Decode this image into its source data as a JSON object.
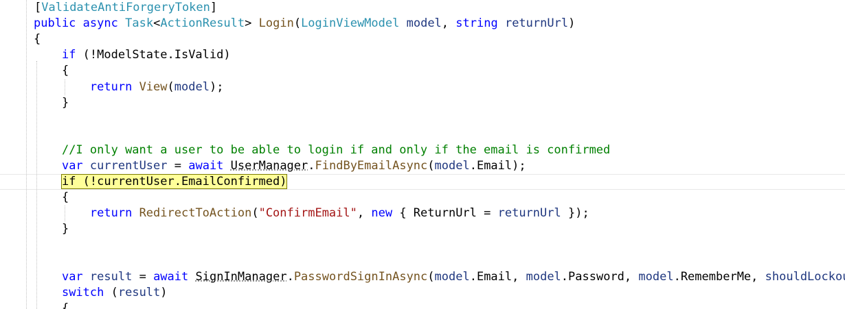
{
  "editor": {
    "language": "csharp",
    "current_line_index": 11,
    "lines": [
      {
        "tokens": [
          {
            "t": "",
            "c": "plain"
          },
          {
            "t": "[",
            "c": "plain"
          },
          {
            "t": "ValidateAntiForgeryToken",
            "c": "type"
          },
          {
            "t": "]",
            "c": "plain"
          }
        ]
      },
      {
        "tokens": [
          {
            "t": "public",
            "c": "kw"
          },
          {
            "t": " ",
            "c": "plain"
          },
          {
            "t": "async",
            "c": "kw"
          },
          {
            "t": " ",
            "c": "plain"
          },
          {
            "t": "Task",
            "c": "type"
          },
          {
            "t": "<",
            "c": "plain"
          },
          {
            "t": "ActionResult",
            "c": "type"
          },
          {
            "t": "> ",
            "c": "plain"
          },
          {
            "t": "Login",
            "c": "mth"
          },
          {
            "t": "(",
            "c": "plain"
          },
          {
            "t": "LoginViewModel",
            "c": "type"
          },
          {
            "t": " ",
            "c": "plain"
          },
          {
            "t": "model",
            "c": "var"
          },
          {
            "t": ", ",
            "c": "plain"
          },
          {
            "t": "string",
            "c": "kw"
          },
          {
            "t": " ",
            "c": "plain"
          },
          {
            "t": "returnUrl",
            "c": "var"
          },
          {
            "t": ")",
            "c": "plain"
          }
        ]
      },
      {
        "tokens": [
          {
            "t": "{",
            "c": "plain"
          }
        ]
      },
      {
        "tokens": [
          {
            "t": "    ",
            "c": "plain"
          },
          {
            "t": "if",
            "c": "kw"
          },
          {
            "t": " (!ModelState.IsValid)",
            "c": "plain"
          }
        ]
      },
      {
        "tokens": [
          {
            "t": "    {",
            "c": "plain"
          }
        ]
      },
      {
        "tokens": [
          {
            "t": "        ",
            "c": "plain"
          },
          {
            "t": "return",
            "c": "kw"
          },
          {
            "t": " ",
            "c": "plain"
          },
          {
            "t": "View",
            "c": "mth"
          },
          {
            "t": "(",
            "c": "plain"
          },
          {
            "t": "model",
            "c": "var"
          },
          {
            "t": ");",
            "c": "plain"
          }
        ]
      },
      {
        "tokens": [
          {
            "t": "    }",
            "c": "plain"
          }
        ]
      },
      {
        "tokens": []
      },
      {
        "tokens": []
      },
      {
        "tokens": [
          {
            "t": "    ",
            "c": "plain"
          },
          {
            "t": "//I only want a user to be able to login if and only if the email is confirmed",
            "c": "cmt"
          }
        ]
      },
      {
        "tokens": [
          {
            "t": "    ",
            "c": "plain"
          },
          {
            "t": "var",
            "c": "kw"
          },
          {
            "t": " ",
            "c": "plain"
          },
          {
            "t": "currentUser",
            "c": "var"
          },
          {
            "t": " = ",
            "c": "plain"
          },
          {
            "t": "await",
            "c": "kw"
          },
          {
            "t": " ",
            "c": "plain"
          },
          {
            "t": "UserManager",
            "c": "plain",
            "squiggle": true
          },
          {
            "t": ".",
            "c": "plain"
          },
          {
            "t": "FindByEmailAsync",
            "c": "mth"
          },
          {
            "t": "(",
            "c": "plain"
          },
          {
            "t": "model",
            "c": "var"
          },
          {
            "t": ".Email);",
            "c": "plain"
          }
        ]
      },
      {
        "tokens": [
          {
            "t": "    ",
            "c": "plain"
          },
          {
            "t": "if (!currentUser.EmailConfirmed)",
            "c": "plain",
            "hl": true
          }
        ]
      },
      {
        "tokens": [
          {
            "t": "    {",
            "c": "plain"
          }
        ]
      },
      {
        "tokens": [
          {
            "t": "        ",
            "c": "plain"
          },
          {
            "t": "return",
            "c": "kw"
          },
          {
            "t": " ",
            "c": "plain"
          },
          {
            "t": "RedirectToAction",
            "c": "mth"
          },
          {
            "t": "(",
            "c": "plain"
          },
          {
            "t": "\"ConfirmEmail\"",
            "c": "str"
          },
          {
            "t": ", ",
            "c": "plain"
          },
          {
            "t": "new",
            "c": "kw"
          },
          {
            "t": " { ReturnUrl = ",
            "c": "plain"
          },
          {
            "t": "returnUrl",
            "c": "var"
          },
          {
            "t": " });",
            "c": "plain"
          }
        ]
      },
      {
        "tokens": [
          {
            "t": "    }",
            "c": "plain"
          }
        ]
      },
      {
        "tokens": []
      },
      {
        "tokens": []
      },
      {
        "tokens": [
          {
            "t": "    ",
            "c": "plain"
          },
          {
            "t": "var",
            "c": "kw"
          },
          {
            "t": " ",
            "c": "plain"
          },
          {
            "t": "result",
            "c": "var"
          },
          {
            "t": " = ",
            "c": "plain"
          },
          {
            "t": "await",
            "c": "kw"
          },
          {
            "t": " ",
            "c": "plain"
          },
          {
            "t": "SignInManager",
            "c": "plain",
            "squiggle": true
          },
          {
            "t": ".",
            "c": "plain"
          },
          {
            "t": "PasswordSignInAsync",
            "c": "mth"
          },
          {
            "t": "(",
            "c": "plain"
          },
          {
            "t": "model",
            "c": "var"
          },
          {
            "t": ".Email, ",
            "c": "plain"
          },
          {
            "t": "model",
            "c": "var"
          },
          {
            "t": ".Password, ",
            "c": "plain"
          },
          {
            "t": "model",
            "c": "var"
          },
          {
            "t": ".RememberMe, ",
            "c": "plain"
          },
          {
            "t": "shouldLockou",
            "c": "var"
          }
        ]
      },
      {
        "tokens": [
          {
            "t": "    ",
            "c": "plain"
          },
          {
            "t": "switch",
            "c": "kw"
          },
          {
            "t": " (",
            "c": "plain"
          },
          {
            "t": "result",
            "c": "var"
          },
          {
            "t": ")",
            "c": "plain"
          }
        ]
      },
      {
        "tokens": [
          {
            "t": "    {",
            "c": "plain"
          }
        ]
      }
    ]
  }
}
